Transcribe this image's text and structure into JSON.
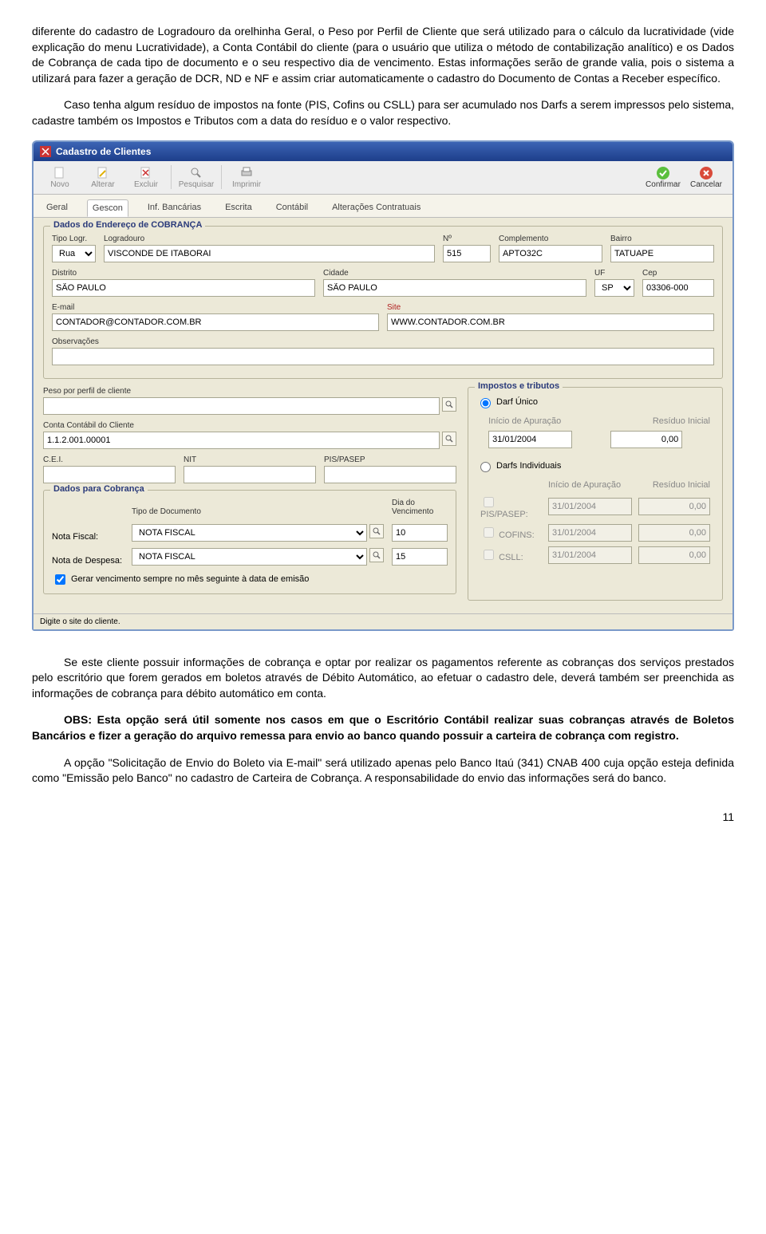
{
  "paragraphs": {
    "p1": "diferente do cadastro de Logradouro da orelhinha Geral, o Peso por Perfil de Cliente que será utilizado para o cálculo da lucratividade (vide explicação do menu Lucratividade), a Conta Contábil do cliente (para o usuário que utiliza o método de contabilização analítico) e os Dados de Cobrança de cada tipo de documento e o seu respectivo dia de vencimento. Estas informações serão de grande valia, pois o sistema a utilizará para fazer a geração de DCR, ND e NF e assim criar automaticamente o cadastro do Documento de Contas a Receber específico.",
    "p2": "Caso tenha algum resíduo de impostos na fonte (PIS, Cofins ou CSLL) para ser acumulado nos Darfs a serem impressos pelo sistema, cadastre também os Impostos e Tributos com a data do resíduo e o valor respectivo.",
    "p3": "Se este cliente possuir informações de cobrança e optar por realizar os pagamentos referente as cobranças dos serviços prestados  pelo escritório que forem gerados em boletos através de Débito Automático, ao efetuar o cadastro dele, deverá também ser preenchida as informações de cobrança para débito automático em conta.",
    "p4": "OBS: Esta opção será útil somente nos casos em que o Escritório Contábil realizar suas cobranças através de Boletos Bancários e fizer a geração do arquivo remessa para envio ao banco quando possuir a carteira de cobrança com registro.",
    "p5": "A opção \"Solicitação de Envio do Boleto via E-mail\" será utilizado apenas pelo Banco Itaú (341) CNAB 400 cuja opção esteja definida como \"Emissão pelo Banco\" no cadastro de Carteira de Cobrança.  A responsabilidade do envio das informações será do banco."
  },
  "window": {
    "title": "Cadastro de Clientes"
  },
  "toolbar": {
    "novo": "Novo",
    "alterar": "Alterar",
    "excluir": "Excluir",
    "pesquisar": "Pesquisar",
    "imprimir": "Imprimir",
    "confirmar": "Confirmar",
    "cancelar": "Cancelar"
  },
  "tabs": {
    "geral": "Geral",
    "gescon": "Gescon",
    "inf": "Inf. Bancárias",
    "escrita": "Escrita",
    "contabil": "Contábil",
    "alter": "Alterações Contratuais"
  },
  "cobranca": {
    "legend": "Dados do Endereço de COBRANÇA",
    "tipoLogrLabel": "Tipo Logr.",
    "tipoLogr": "Rua",
    "logradouroLabel": "Logradouro",
    "logradouro": "VISCONDE DE ITABORAI",
    "numLabel": "Nº",
    "num": "515",
    "complLabel": "Complemento",
    "compl": "APTO32C",
    "bairroLabel": "Bairro",
    "bairro": "TATUAPE",
    "distritoLabel": "Distrito",
    "distrito": "SÃO PAULO",
    "cidadeLabel": "Cidade",
    "cidade": "SÃO PAULO",
    "ufLabel": "UF",
    "uf": "SP",
    "cepLabel": "Cep",
    "cep": "03306-000",
    "emailLabel": "E-mail",
    "email": "CONTADOR@CONTADOR.COM.BR",
    "siteLabel": "Site",
    "site": "WWW.CONTADOR.COM.BR",
    "obsLabel": "Observações",
    "obs": ""
  },
  "left": {
    "pesoLabel": "Peso por perfil de cliente",
    "peso": "",
    "contaLabel": "Conta Contábil do Cliente",
    "conta": "1.1.2.001.00001",
    "ceiLabel": "C.E.I.",
    "cei": "",
    "nitLabel": "NIT",
    "nit": "",
    "pisLabel": "PIS/PASEP",
    "pis": ""
  },
  "cobGroup": {
    "legend": "Dados para Cobrança",
    "tipoDocLabel": "Tipo de Documento",
    "diaVencLabel": "Dia do Vencimento",
    "notaFiscalLabel": "Nota Fiscal:",
    "notaFiscal": "NOTA FISCAL",
    "notaFiscalDia": "10",
    "notaDespLabel": "Nota de Despesa:",
    "notaDesp": "NOTA FISCAL",
    "notaDespDia": "15",
    "checkLabel": "Gerar vencimento sempre no mês seguinte à data de emisão"
  },
  "impostos": {
    "legend": "Impostos e tributos",
    "darfUnico": "Darf Único",
    "inicioLabel": "Início de Apuração",
    "residuoLabel": "Resíduo Inicial",
    "darfUnicoData": "31/01/2004",
    "darfUnicoVal": "0,00",
    "darfsInd": "Darfs Individuais",
    "pisLabel": "PIS/PASEP:",
    "pisData": "31/01/2004",
    "pisVal": "0,00",
    "cofinsLabel": "COFINS:",
    "cofinsData": "31/01/2004",
    "cofinsVal": "0,00",
    "csllLabel": "CSLL:",
    "csllData": "31/01/2004",
    "csllVal": "0,00"
  },
  "status": "Digite o site do cliente.",
  "pagenum": "11"
}
